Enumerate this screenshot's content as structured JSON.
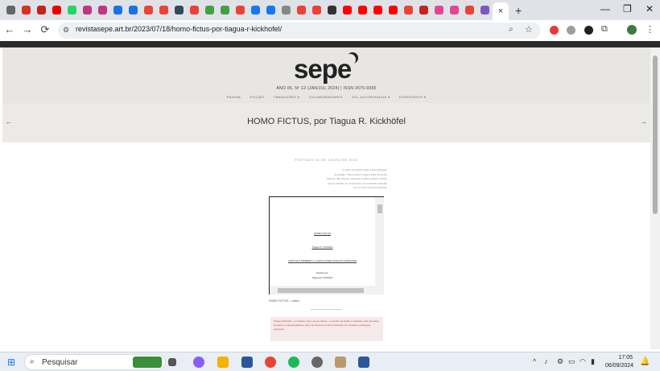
{
  "browser": {
    "url": "revistasepe.art.br/2023/07/18/homo-fictus-por-tiagua-r-kickhofel/",
    "tab_close": "×",
    "new_tab": "+",
    "window_controls": {
      "minimize": "—",
      "maximize": "❐",
      "close": "✕"
    },
    "nav": {
      "back": "←",
      "forward": "→",
      "reload": "⟳"
    },
    "tab_colors": [
      "#666",
      "#d93025",
      "#c5221f",
      "#e00",
      "#25d366",
      "#c13584",
      "#c13584",
      "#1a73e8",
      "#1a73e8",
      "#ea4335",
      "#ea4335",
      "#34495e",
      "#ea4335",
      "#43a047",
      "#43a047",
      "#ea4335",
      "#1877f2",
      "#1877f2",
      "#888",
      "#ea4335",
      "#ea4335",
      "#333",
      "#ff0000",
      "#ff0000",
      "#ff0000",
      "#ff0000",
      "#ea4335",
      "#c5221f",
      "#e84393",
      "#e84393",
      "#ea4335",
      "#7e57c2"
    ]
  },
  "site": {
    "logo": "sepe",
    "issue": "ANO 05, Nº 12 (JAN/JUL 2024)   |   ISSN 2675-9365",
    "menu": [
      "PÁGINA",
      "FICÇÃO",
      "TRADUÇÕES ▾",
      "COLABORADORES",
      "SOL AUTORIZADOS ▾",
      "EXPEDIENTE ▾"
    ],
    "post_title": "HOMO FICTUS, por Tiagua R. Kickhöfel",
    "prev_arrow": "←",
    "next_arrow": "→",
    "posted": "POSTADO 18 DE JULHO DE 2023",
    "epigraph": [
      "O ofício do escritor exige a aprendizagem",
      "da solidão. \"Homo Fictus\" surge a partir do Homo",
      "Sapiens. Ele escreve, descreve e fabrica outros mundos",
      "que se mantêm em movimento, em constante invenção",
      "de um novo horizonte possível."
    ],
    "doc_lines": [
      "HOMO FICTUS",
      "Tiagua R. Kickhöfel",
      "CAPÍTULO PRIMEIRO: A LINHA CONDUTORA DO ROMANCE",
      "Escrito por",
      "Tiagua R. Kickhöfel"
    ],
    "caption": "HOMO FICTUS – roteiro",
    "bio": "Tiagua Kickhöfel – ou Tiagua, como ele se chama – é escritor de ficção e roteirista, autor de obras literárias e cinematográficas, autor de diversos contos publicados em revistas e antologias nacionais."
  },
  "taskbar": {
    "search_placeholder": "Pesquisar",
    "time": "17:05",
    "date": "06/09/2024"
  }
}
